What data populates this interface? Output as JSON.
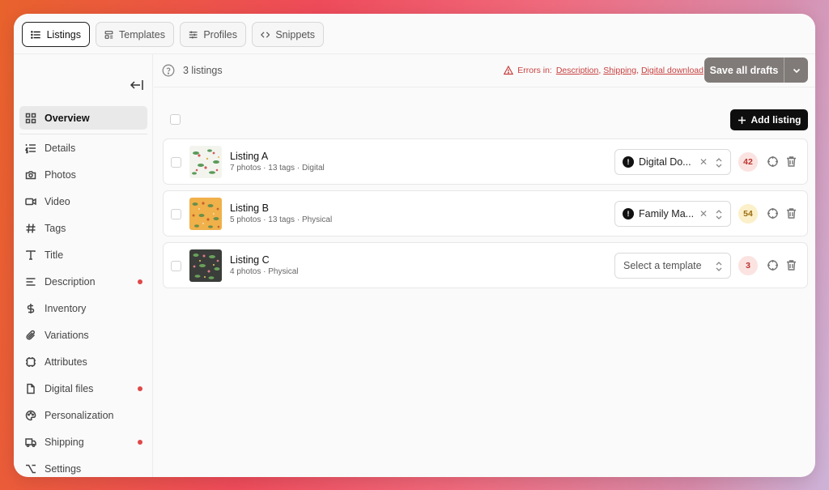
{
  "tabs": [
    {
      "label": "Listings",
      "icon": "list-icon",
      "active": true
    },
    {
      "label": "Templates",
      "icon": "layout-icon",
      "active": false
    },
    {
      "label": "Profiles",
      "icon": "sliders-icon",
      "active": false
    },
    {
      "label": "Snippets",
      "icon": "code-icon",
      "active": false
    }
  ],
  "sidebar": {
    "items": [
      {
        "label": "Overview",
        "icon": "grid-icon",
        "active": true,
        "error": false
      },
      {
        "label": "Details",
        "icon": "list-numbered-icon",
        "active": false,
        "error": false
      },
      {
        "label": "Photos",
        "icon": "camera-icon",
        "active": false,
        "error": false
      },
      {
        "label": "Video",
        "icon": "video-icon",
        "active": false,
        "error": false
      },
      {
        "label": "Tags",
        "icon": "hash-icon",
        "active": false,
        "error": false
      },
      {
        "label": "Title",
        "icon": "type-icon",
        "active": false,
        "error": false
      },
      {
        "label": "Description",
        "icon": "align-left-icon",
        "active": false,
        "error": true
      },
      {
        "label": "Inventory",
        "icon": "dollar-icon",
        "active": false,
        "error": false
      },
      {
        "label": "Variations",
        "icon": "paperclip-icon",
        "active": false,
        "error": false
      },
      {
        "label": "Attributes",
        "icon": "chip-icon",
        "active": false,
        "error": false
      },
      {
        "label": "Digital files",
        "icon": "file-icon",
        "active": false,
        "error": true
      },
      {
        "label": "Personalization",
        "icon": "palette-icon",
        "active": false,
        "error": false
      },
      {
        "label": "Shipping",
        "icon": "truck-icon",
        "active": false,
        "error": true
      },
      {
        "label": "Settings",
        "icon": "option-key-icon",
        "active": false,
        "error": false
      }
    ]
  },
  "header": {
    "count_label": "3 listings",
    "errors_prefix": "Errors in:",
    "error_links": [
      "Description",
      "Shipping",
      "Digital download"
    ],
    "save_label": "Save all drafts"
  },
  "add_listing_label": "Add listing",
  "listings": [
    {
      "name": "Listing A",
      "meta": "7 photos · 13 tags · Digital",
      "template": "Digital Do...",
      "template_placeholder": "",
      "score": "42",
      "score_color": "red",
      "thumb": "white"
    },
    {
      "name": "Listing B",
      "meta": "5 photos · 13 tags · Physical",
      "template": "Family Ma...",
      "template_placeholder": "",
      "score": "54",
      "score_color": "yellow",
      "thumb": "orange"
    },
    {
      "name": "Listing C",
      "meta": "4 photos · Physical",
      "template": "",
      "template_placeholder": "Select a template",
      "score": "3",
      "score_color": "red",
      "thumb": "dark"
    }
  ],
  "colors": {
    "accent": "#0e0e0e",
    "error": "#c94040",
    "save_button": "#807b78"
  }
}
